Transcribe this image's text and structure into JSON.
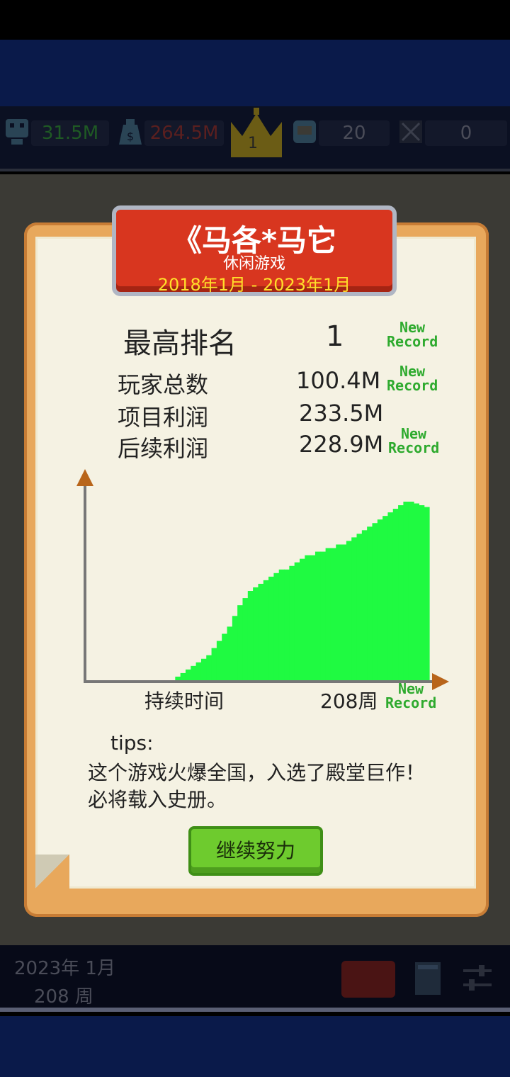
{
  "stats": {
    "players": "31.5M",
    "money": "264.5M",
    "rank": "1",
    "fans": "20",
    "bugs": "0"
  },
  "dialog": {
    "title": "《马各*马它",
    "genre": "休闲游戏",
    "period": "2018年1月 - 2023年1月",
    "rows": [
      {
        "label": "最高排名",
        "value": "1"
      },
      {
        "label": "玩家总数",
        "value": "100.4M"
      },
      {
        "label": "项目利润",
        "value": "233.5M"
      },
      {
        "label": "后续利润",
        "value": "228.9M"
      }
    ],
    "new_record": "New Record",
    "chart_xlabel": "持续时间",
    "chart_xvalue": "208周",
    "tips_label": "tips:",
    "tips_text": "这个游戏火爆全国，入选了殿堂巨作！必将载入史册。",
    "continue_label": "继续努力"
  },
  "bottom": {
    "date": "2023年 1月",
    "week": "208 周"
  },
  "colors": {
    "chart_fill": "#1ffa41",
    "banner": "#d8361f",
    "button": "#6ecb2e"
  },
  "chart_data": {
    "type": "area",
    "xlabel": "持续时间",
    "x_label_value": "208周",
    "xlim": [
      0,
      208
    ],
    "values": [
      0,
      2,
      4,
      6,
      8,
      10,
      12,
      14,
      18,
      22,
      26,
      30,
      36,
      42,
      46,
      50,
      52,
      54,
      56,
      58,
      60,
      62,
      62,
      64,
      66,
      68,
      70,
      70,
      72,
      72,
      74,
      74,
      76,
      76,
      78,
      80,
      82,
      84,
      86,
      88,
      90,
      92,
      94,
      96,
      98,
      100,
      100,
      99,
      98,
      97
    ]
  }
}
